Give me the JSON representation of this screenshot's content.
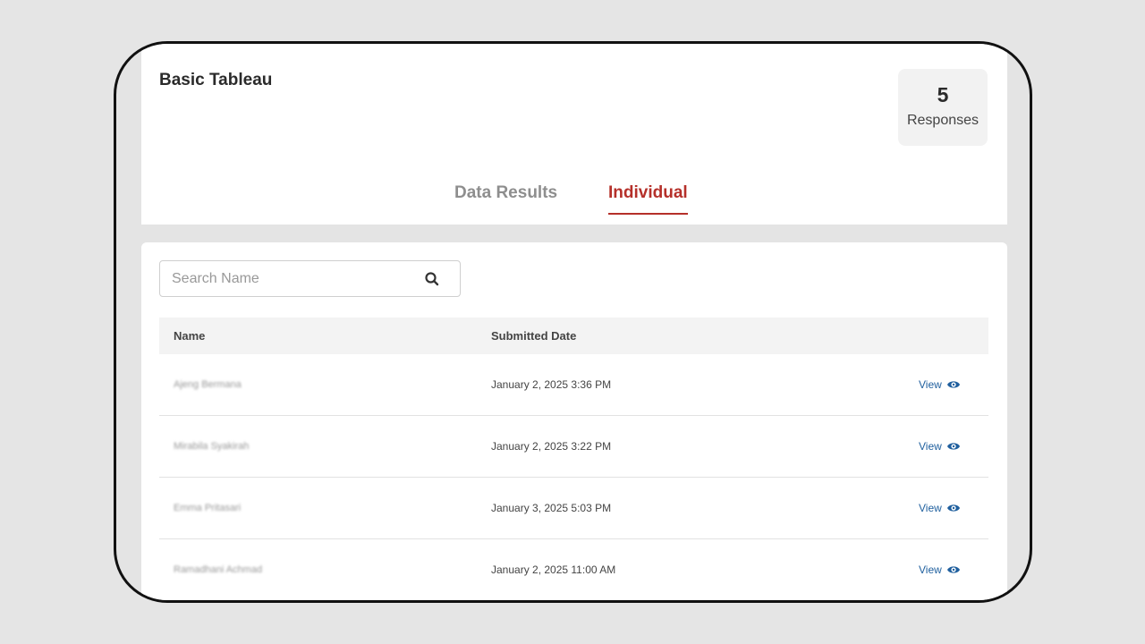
{
  "survey": {
    "title": "Basic Tableau",
    "response_count": "5",
    "response_label": "Responses"
  },
  "tabs": [
    {
      "label": "Data Results",
      "active": false
    },
    {
      "label": "Individual",
      "active": true
    }
  ],
  "search": {
    "placeholder": "Search Name",
    "value": ""
  },
  "table": {
    "columns": [
      "Name",
      "Submitted Date"
    ],
    "rows": [
      {
        "name": "Ajeng Bermana",
        "date": "January 2, 2025 3:36 PM",
        "action": "View"
      },
      {
        "name": "Mirabila Syakirah",
        "date": "January 2, 2025 3:22 PM",
        "action": "View"
      },
      {
        "name": "Emma Pritasari",
        "date": "January 3, 2025 5:03 PM",
        "action": "View"
      },
      {
        "name": "Ramadhani Achmad",
        "date": "January 2, 2025 11:00 AM",
        "action": "View"
      }
    ]
  },
  "colors": {
    "accent": "#b5302a",
    "link": "#1f5f9e"
  },
  "icons": {
    "search": "search-icon",
    "view": "eye-icon"
  }
}
